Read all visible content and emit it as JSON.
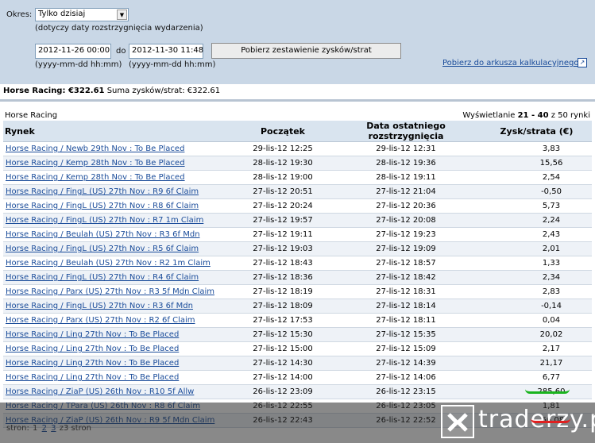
{
  "filter": {
    "period_label": "Okres:",
    "period_value": "Tylko dzisiaj",
    "period_note": "(dotyczy daty rozstrzygnięcia wydarzenia)",
    "date_from": "2012-11-26 00:00",
    "date_to_label": "do",
    "date_to": "2012-11-30 11:48",
    "date_format_hint": "(yyyy-mm-dd hh:mm)",
    "fetch_button": "Pobierz zestawienie zysków/strat",
    "spreadsheet_link": "Pobierz do arkusza kalkulacyjnego"
  },
  "summary": {
    "category_total": "Horse Racing: €322.61",
    "sum_label": "Suma zysków/strat:",
    "sum_value": "€322.61"
  },
  "section_title": "Horse Racing",
  "showing": {
    "prefix": "Wyświetlanie",
    "range": "21 - 40",
    "suffix": "z 50 rynki"
  },
  "table": {
    "headers": [
      "Rynek",
      "Początek",
      "Data ostatniego rozstrzygnięcia",
      "Zysk/strata (€)"
    ],
    "rows": [
      {
        "market": "Horse Racing / Newb 29th Nov : To Be Placed",
        "start": "29-lis-12 12:25",
        "settled": "29-lis-12 12:31",
        "pl": "3,83"
      },
      {
        "market": "Horse Racing / Kemp 28th Nov : To Be Placed",
        "start": "28-lis-12 19:30",
        "settled": "28-lis-12 19:36",
        "pl": "15,56"
      },
      {
        "market": "Horse Racing / Kemp 28th Nov : To Be Placed",
        "start": "28-lis-12 19:00",
        "settled": "28-lis-12 19:11",
        "pl": "2,54"
      },
      {
        "market": "Horse Racing / FingL (US) 27th Nov : R9 6f Claim",
        "start": "27-lis-12 20:51",
        "settled": "27-lis-12 21:04",
        "pl": "-0,50"
      },
      {
        "market": "Horse Racing / FingL (US) 27th Nov : R8 6f Claim",
        "start": "27-lis-12 20:24",
        "settled": "27-lis-12 20:36",
        "pl": "5,73"
      },
      {
        "market": "Horse Racing / FingL (US) 27th Nov : R7 1m Claim",
        "start": "27-lis-12 19:57",
        "settled": "27-lis-12 20:08",
        "pl": "2,24"
      },
      {
        "market": "Horse Racing / Beulah (US) 27th Nov : R3 6f Mdn",
        "start": "27-lis-12 19:11",
        "settled": "27-lis-12 19:23",
        "pl": "2,43"
      },
      {
        "market": "Horse Racing / FingL (US) 27th Nov : R5 6f Claim",
        "start": "27-lis-12 19:03",
        "settled": "27-lis-12 19:09",
        "pl": "2,01"
      },
      {
        "market": "Horse Racing / Beulah (US) 27th Nov : R2 1m Claim",
        "start": "27-lis-12 18:43",
        "settled": "27-lis-12 18:57",
        "pl": "1,33"
      },
      {
        "market": "Horse Racing / FingL (US) 27th Nov : R4 6f Claim",
        "start": "27-lis-12 18:36",
        "settled": "27-lis-12 18:42",
        "pl": "2,34"
      },
      {
        "market": "Horse Racing / Parx (US) 27th Nov : R3 5f Mdn Claim",
        "start": "27-lis-12 18:19",
        "settled": "27-lis-12 18:31",
        "pl": "2,83"
      },
      {
        "market": "Horse Racing / FingL (US) 27th Nov : R3 6f Mdn",
        "start": "27-lis-12 18:09",
        "settled": "27-lis-12 18:14",
        "pl": "-0,14"
      },
      {
        "market": "Horse Racing / Parx (US) 27th Nov : R2 6f Claim",
        "start": "27-lis-12 17:53",
        "settled": "27-lis-12 18:11",
        "pl": "0,04"
      },
      {
        "market": "Horse Racing / Ling 27th Nov : To Be Placed",
        "start": "27-lis-12 15:30",
        "settled": "27-lis-12 15:35",
        "pl": "20,02"
      },
      {
        "market": "Horse Racing / Ling 27th Nov : To Be Placed",
        "start": "27-lis-12 15:00",
        "settled": "27-lis-12 15:09",
        "pl": "2,17"
      },
      {
        "market": "Horse Racing / Ling 27th Nov : To Be Placed",
        "start": "27-lis-12 14:30",
        "settled": "27-lis-12 14:39",
        "pl": "21,17"
      },
      {
        "market": "Horse Racing / Ling 27th Nov : To Be Placed",
        "start": "27-lis-12 14:00",
        "settled": "27-lis-12 14:06",
        "pl": "6,77"
      },
      {
        "market": "Horse Racing / ZiaP (US) 26th Nov : R10 5f Allw",
        "start": "26-lis-12 23:09",
        "settled": "26-lis-12 23:15",
        "pl": "285,60"
      },
      {
        "market": "Horse Racing / TPara (US) 26th Nov : R8 6f Claim",
        "start": "26-lis-12 22:55",
        "settled": "26-lis-12 23:05",
        "pl": "1,81"
      },
      {
        "market": "Horse Racing / ZiaP (US) 26th Nov : R9 5f Mdn Claim",
        "start": "26-lis-12 22:43",
        "settled": "26-lis-12 22:52",
        "pl": "-66,08"
      }
    ]
  },
  "pager": {
    "label": "stron:",
    "pages": [
      "1",
      "2",
      "3"
    ],
    "current": "1",
    "total": "z3 stron"
  },
  "watermark": "traderzy.pl",
  "colors": {
    "panel_bg": "#c9d7e6",
    "header_bg": "#d9e4ef",
    "link": "#1a4c9a",
    "highlight_green": "#19b41e",
    "highlight_red": "#e02020"
  }
}
